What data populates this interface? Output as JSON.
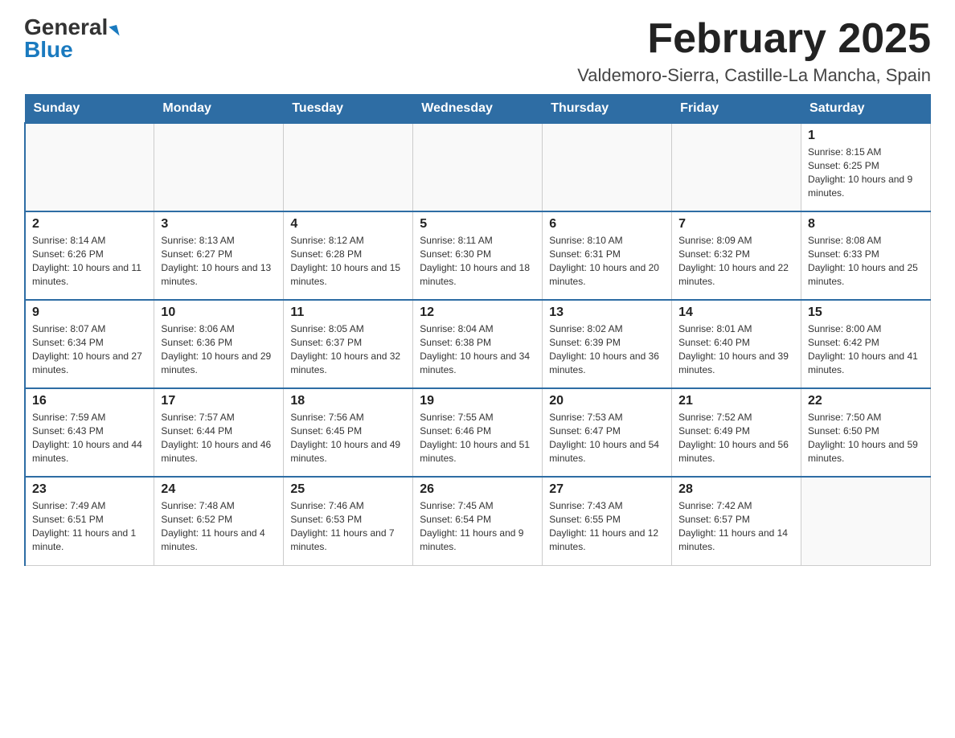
{
  "logo": {
    "general": "General",
    "blue": "Blue"
  },
  "title": "February 2025",
  "subtitle": "Valdemoro-Sierra, Castille-La Mancha, Spain",
  "headers": [
    "Sunday",
    "Monday",
    "Tuesday",
    "Wednesday",
    "Thursday",
    "Friday",
    "Saturday"
  ],
  "weeks": [
    [
      {
        "day": "",
        "info": ""
      },
      {
        "day": "",
        "info": ""
      },
      {
        "day": "",
        "info": ""
      },
      {
        "day": "",
        "info": ""
      },
      {
        "day": "",
        "info": ""
      },
      {
        "day": "",
        "info": ""
      },
      {
        "day": "1",
        "info": "Sunrise: 8:15 AM\nSunset: 6:25 PM\nDaylight: 10 hours and 9 minutes."
      }
    ],
    [
      {
        "day": "2",
        "info": "Sunrise: 8:14 AM\nSunset: 6:26 PM\nDaylight: 10 hours and 11 minutes."
      },
      {
        "day": "3",
        "info": "Sunrise: 8:13 AM\nSunset: 6:27 PM\nDaylight: 10 hours and 13 minutes."
      },
      {
        "day": "4",
        "info": "Sunrise: 8:12 AM\nSunset: 6:28 PM\nDaylight: 10 hours and 15 minutes."
      },
      {
        "day": "5",
        "info": "Sunrise: 8:11 AM\nSunset: 6:30 PM\nDaylight: 10 hours and 18 minutes."
      },
      {
        "day": "6",
        "info": "Sunrise: 8:10 AM\nSunset: 6:31 PM\nDaylight: 10 hours and 20 minutes."
      },
      {
        "day": "7",
        "info": "Sunrise: 8:09 AM\nSunset: 6:32 PM\nDaylight: 10 hours and 22 minutes."
      },
      {
        "day": "8",
        "info": "Sunrise: 8:08 AM\nSunset: 6:33 PM\nDaylight: 10 hours and 25 minutes."
      }
    ],
    [
      {
        "day": "9",
        "info": "Sunrise: 8:07 AM\nSunset: 6:34 PM\nDaylight: 10 hours and 27 minutes."
      },
      {
        "day": "10",
        "info": "Sunrise: 8:06 AM\nSunset: 6:36 PM\nDaylight: 10 hours and 29 minutes."
      },
      {
        "day": "11",
        "info": "Sunrise: 8:05 AM\nSunset: 6:37 PM\nDaylight: 10 hours and 32 minutes."
      },
      {
        "day": "12",
        "info": "Sunrise: 8:04 AM\nSunset: 6:38 PM\nDaylight: 10 hours and 34 minutes."
      },
      {
        "day": "13",
        "info": "Sunrise: 8:02 AM\nSunset: 6:39 PM\nDaylight: 10 hours and 36 minutes."
      },
      {
        "day": "14",
        "info": "Sunrise: 8:01 AM\nSunset: 6:40 PM\nDaylight: 10 hours and 39 minutes."
      },
      {
        "day": "15",
        "info": "Sunrise: 8:00 AM\nSunset: 6:42 PM\nDaylight: 10 hours and 41 minutes."
      }
    ],
    [
      {
        "day": "16",
        "info": "Sunrise: 7:59 AM\nSunset: 6:43 PM\nDaylight: 10 hours and 44 minutes."
      },
      {
        "day": "17",
        "info": "Sunrise: 7:57 AM\nSunset: 6:44 PM\nDaylight: 10 hours and 46 minutes."
      },
      {
        "day": "18",
        "info": "Sunrise: 7:56 AM\nSunset: 6:45 PM\nDaylight: 10 hours and 49 minutes."
      },
      {
        "day": "19",
        "info": "Sunrise: 7:55 AM\nSunset: 6:46 PM\nDaylight: 10 hours and 51 minutes."
      },
      {
        "day": "20",
        "info": "Sunrise: 7:53 AM\nSunset: 6:47 PM\nDaylight: 10 hours and 54 minutes."
      },
      {
        "day": "21",
        "info": "Sunrise: 7:52 AM\nSunset: 6:49 PM\nDaylight: 10 hours and 56 minutes."
      },
      {
        "day": "22",
        "info": "Sunrise: 7:50 AM\nSunset: 6:50 PM\nDaylight: 10 hours and 59 minutes."
      }
    ],
    [
      {
        "day": "23",
        "info": "Sunrise: 7:49 AM\nSunset: 6:51 PM\nDaylight: 11 hours and 1 minute."
      },
      {
        "day": "24",
        "info": "Sunrise: 7:48 AM\nSunset: 6:52 PM\nDaylight: 11 hours and 4 minutes."
      },
      {
        "day": "25",
        "info": "Sunrise: 7:46 AM\nSunset: 6:53 PM\nDaylight: 11 hours and 7 minutes."
      },
      {
        "day": "26",
        "info": "Sunrise: 7:45 AM\nSunset: 6:54 PM\nDaylight: 11 hours and 9 minutes."
      },
      {
        "day": "27",
        "info": "Sunrise: 7:43 AM\nSunset: 6:55 PM\nDaylight: 11 hours and 12 minutes."
      },
      {
        "day": "28",
        "info": "Sunrise: 7:42 AM\nSunset: 6:57 PM\nDaylight: 11 hours and 14 minutes."
      },
      {
        "day": "",
        "info": ""
      }
    ]
  ]
}
